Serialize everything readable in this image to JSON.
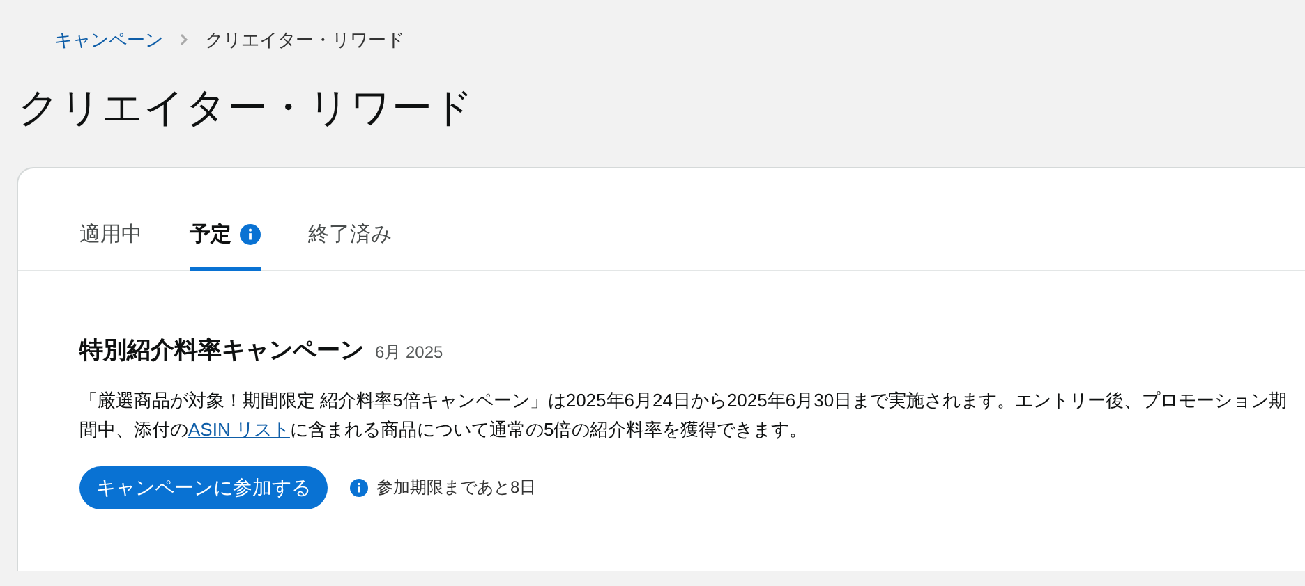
{
  "breadcrumb": [
    {
      "label": "キャンペーン",
      "link": true
    },
    {
      "label": "クリエイター・リワード",
      "link": false
    }
  ],
  "page_title": "クリエイター・リワード",
  "tabs": [
    {
      "label": "適用中",
      "selected": false,
      "info": false
    },
    {
      "label": "予定",
      "selected": true,
      "info": true
    },
    {
      "label": "終了済み",
      "selected": false,
      "info": false
    }
  ],
  "campaign": {
    "title": "特別紹介料率キャンペーン",
    "date": "6月 2025",
    "description": {
      "before": "「厳選商品が対象！期間限定 紹介料率5倍キャンペーン」は2025年6月24日から2025年6月30日まで実施されます。エントリー後、プロモーション期間中、添付の",
      "link": "ASIN リスト",
      "after": "に含まれる商品について通常の5倍の紹介料率を獲得できます。"
    },
    "button": "キャンペーンに参加する",
    "deadline": "参加期限まであと8日"
  }
}
